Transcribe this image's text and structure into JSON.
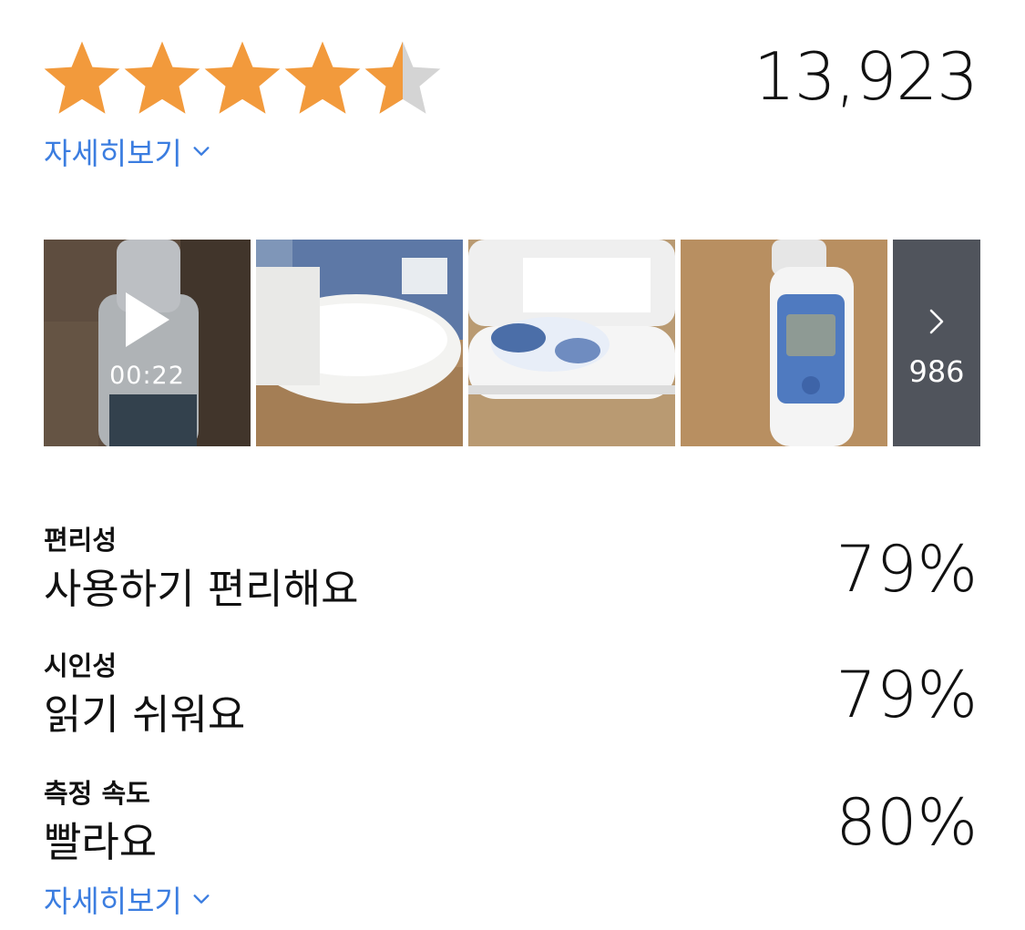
{
  "rating": {
    "stars_filled": 4.5,
    "stars_total": 5,
    "review_count": "13,923",
    "star_color": "#f29a3c",
    "star_empty_color": "#d4d4d4"
  },
  "links": {
    "details_top": "자세히보기",
    "details_bottom": "자세히보기",
    "link_color": "#3b7de0"
  },
  "photos": {
    "video_duration": "00:22",
    "more_count": "986",
    "items": [
      {
        "kind": "video",
        "icon": "play-icon"
      },
      {
        "kind": "photo"
      },
      {
        "kind": "photo"
      },
      {
        "kind": "photo"
      }
    ]
  },
  "attributes": [
    {
      "label": "편리성",
      "value": "사용하기 편리해요",
      "percent": "79%"
    },
    {
      "label": "시인성",
      "value": "읽기 쉬워요",
      "percent": "79%"
    },
    {
      "label": "측정 속도",
      "value": "빨라요",
      "percent": "80%"
    }
  ]
}
